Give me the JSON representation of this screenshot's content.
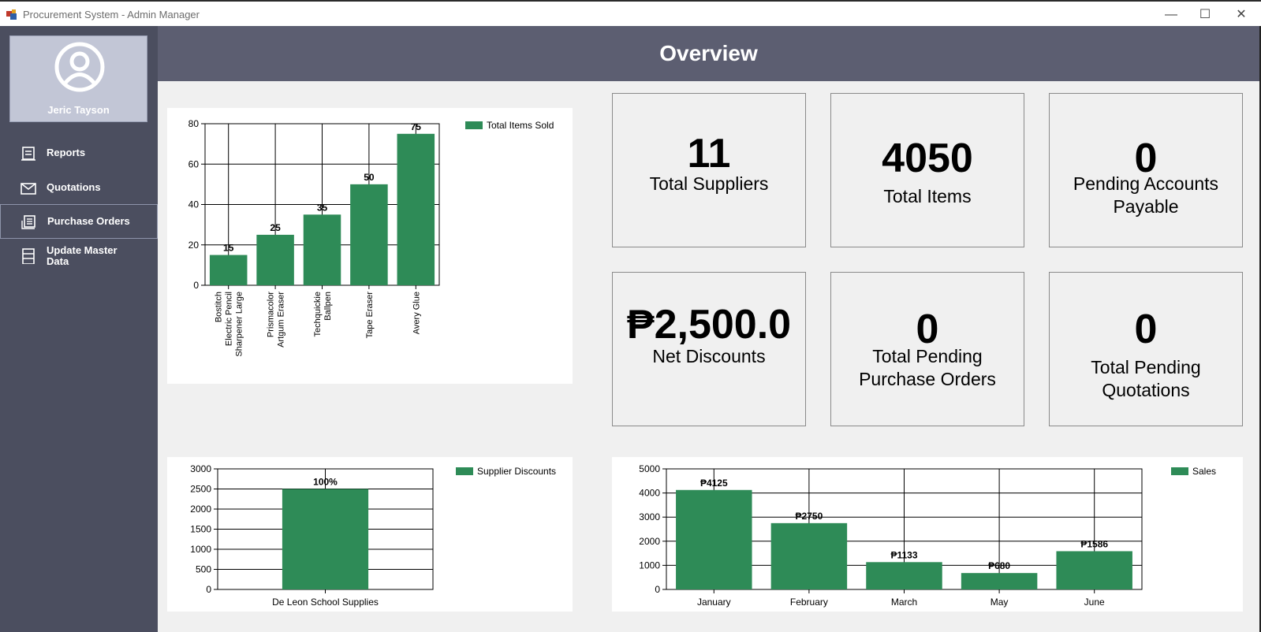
{
  "window": {
    "title": "Procurement System - Admin Manager",
    "minimize": "—",
    "maximize": "☐",
    "close": "✕"
  },
  "sidebar": {
    "user_name": "Jeric Tayson",
    "items": [
      {
        "label": "Reports",
        "icon": "reports-icon"
      },
      {
        "label": "Quotations",
        "icon": "envelope-icon"
      },
      {
        "label": "Purchase Orders",
        "icon": "purchase-orders-icon",
        "active": true
      },
      {
        "label": "Update Master Data",
        "icon": "database-icon"
      }
    ]
  },
  "header": {
    "title": "Overview"
  },
  "cards": [
    {
      "value": "11",
      "caption": "Total Suppliers"
    },
    {
      "value": "4050",
      "caption": "Total Items"
    },
    {
      "value": "0",
      "caption": "Pending Accounts Payable"
    },
    {
      "value": "₱2,500.0",
      "caption": "Net Discounts"
    },
    {
      "value": "0",
      "caption": "Total Pending Purchase Orders"
    },
    {
      "value": "0",
      "caption": "Total Pending Quotations"
    }
  ],
  "colors": {
    "bar": "#2e8b57",
    "sidebar": "#4b4e5f",
    "header": "#5c5e71"
  },
  "chart_data": [
    {
      "type": "bar",
      "categories": [
        "Bostitch Electric Pencil Sharpener Large",
        "Prismacolor Artgum Eraser",
        "Techquickie Ballpen",
        "Tape Eraser",
        "Avery Glue"
      ],
      "values": [
        15,
        25,
        35,
        50,
        75
      ],
      "data_labels": [
        "15",
        "25",
        "35",
        "50",
        "75"
      ],
      "series": [
        {
          "name": "Total Items Sold",
          "values": [
            15,
            25,
            35,
            50,
            75
          ]
        }
      ],
      "ylim": [
        0,
        80
      ],
      "yticks": [
        "0",
        "20",
        "40",
        "60",
        "80"
      ],
      "grid": true,
      "legend": "top-right"
    },
    {
      "type": "bar",
      "categories": [
        "De Leon School Supplies"
      ],
      "values": [
        2500
      ],
      "data_labels": [
        "100%"
      ],
      "series": [
        {
          "name": "Supplier Discounts",
          "values": [
            2500
          ]
        }
      ],
      "ylim": [
        0,
        3000
      ],
      "yticks": [
        "0",
        "500",
        "1000",
        "1500",
        "2000",
        "2500",
        "3000"
      ],
      "grid": true,
      "legend": "top-right"
    },
    {
      "type": "bar",
      "categories": [
        "January",
        "February",
        "March",
        "May",
        "June"
      ],
      "values": [
        4125,
        2750,
        1133,
        680,
        1586
      ],
      "data_labels": [
        "₱4125",
        "₱2750",
        "₱1133",
        "₱680",
        "₱1586"
      ],
      "series": [
        {
          "name": "Sales",
          "values": [
            4125,
            2750,
            1133,
            680,
            1586
          ]
        }
      ],
      "ylim": [
        0,
        5000
      ],
      "yticks": [
        "0",
        "1000",
        "2000",
        "3000",
        "4000",
        "5000"
      ],
      "grid": true,
      "legend": "top-right"
    }
  ]
}
